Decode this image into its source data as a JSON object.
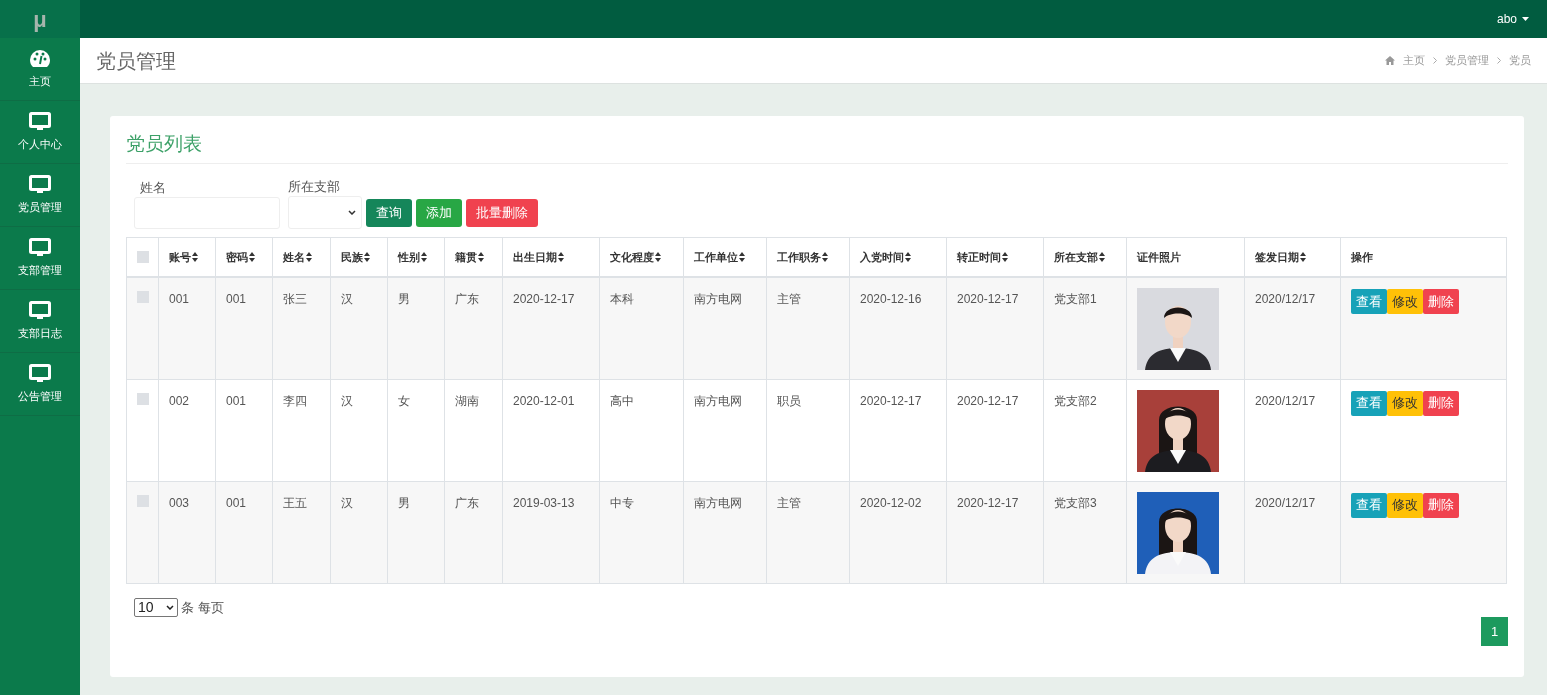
{
  "app": {
    "logo": "μ",
    "user": "abo"
  },
  "sidebar": {
    "items": [
      {
        "label": "主页"
      },
      {
        "label": "个人中心"
      },
      {
        "label": "党员管理"
      },
      {
        "label": "支部管理"
      },
      {
        "label": "支部日志"
      },
      {
        "label": "公告管理"
      }
    ]
  },
  "page": {
    "title": "党员管理",
    "breadcrumb": [
      "主页",
      "党员管理",
      "党员"
    ]
  },
  "card": {
    "title": "党员列表"
  },
  "filters": {
    "name_label": "姓名",
    "branch_label": "所在支部",
    "buttons": [
      {
        "label": "查询",
        "kind": "query"
      },
      {
        "label": "添加",
        "kind": "add"
      },
      {
        "label": "批量删除",
        "kind": "delete"
      }
    ]
  },
  "table": {
    "select_all": {
      "checked": false
    },
    "columns": [
      {
        "label": "账号",
        "sortable": true
      },
      {
        "label": "密码",
        "sortable": true
      },
      {
        "label": "姓名",
        "sortable": true
      },
      {
        "label": "民族",
        "sortable": true
      },
      {
        "label": "性别",
        "sortable": true
      },
      {
        "label": "籍贯",
        "sortable": true
      },
      {
        "label": "出生日期",
        "sortable": true
      },
      {
        "label": "文化程度",
        "sortable": true
      },
      {
        "label": "工作单位",
        "sortable": true
      },
      {
        "label": "工作职务",
        "sortable": true
      },
      {
        "label": "入党时间",
        "sortable": true
      },
      {
        "label": "转正时间",
        "sortable": true
      },
      {
        "label": "所在支部",
        "sortable": true
      },
      {
        "label": "证件照片",
        "sortable": false
      },
      {
        "label": "签发日期",
        "sortable": true
      },
      {
        "label": "操作",
        "sortable": false
      }
    ],
    "rows": [
      {
        "checked": false,
        "cells": [
          "001",
          "001",
          "张三",
          "汉",
          "男",
          "广东",
          "2020-12-17",
          "本科",
          "南方电网",
          "主管",
          "2020-12-16",
          "2020-12-17",
          "党支部1"
        ],
        "issued": "2020/12/17",
        "actions": [
          {
            "label": "查看",
            "kind": "view"
          },
          {
            "label": "修改",
            "kind": "edit"
          },
          {
            "label": "删除",
            "kind": "delete"
          }
        ]
      },
      {
        "checked": false,
        "cells": [
          "002",
          "001",
          "李四",
          "汉",
          "女",
          "湖南",
          "2020-12-01",
          "高中",
          "南方电网",
          "职员",
          "2020-12-17",
          "2020-12-17",
          "党支部2"
        ],
        "issued": "2020/12/17",
        "actions": [
          {
            "label": "查看",
            "kind": "view"
          },
          {
            "label": "修改",
            "kind": "edit"
          },
          {
            "label": "删除",
            "kind": "delete"
          }
        ]
      },
      {
        "checked": false,
        "cells": [
          "003",
          "001",
          "王五",
          "汉",
          "男",
          "广东",
          "2019-03-13",
          "中专",
          "南方电网",
          "主管",
          "2020-12-02",
          "2020-12-17",
          "党支部3"
        ],
        "issued": "2020/12/17",
        "actions": [
          {
            "label": "查看",
            "kind": "view"
          },
          {
            "label": "修改",
            "kind": "edit"
          },
          {
            "label": "删除",
            "kind": "delete"
          }
        ]
      }
    ]
  },
  "pagination": {
    "page_size": "10",
    "page_size_suffix": "条 每页",
    "pages": [
      {
        "label": "1",
        "selected": true
      }
    ]
  }
}
